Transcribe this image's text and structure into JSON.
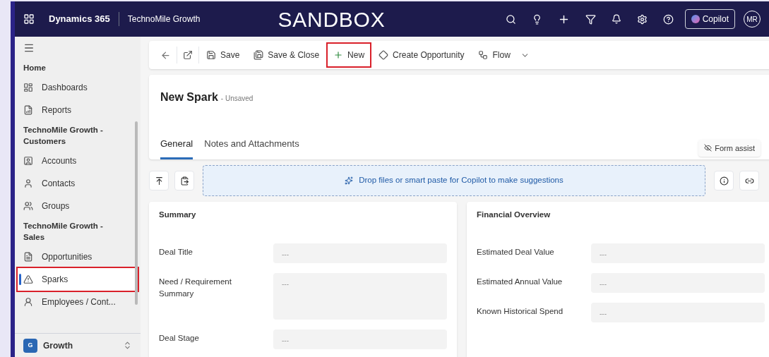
{
  "header": {
    "brand": "Dynamics 365",
    "app": "TechnoMile Growth",
    "environment": "SANDBOX",
    "copilot": "Copilot",
    "avatar": "MR"
  },
  "sidebar": {
    "groups": [
      {
        "title": "Home",
        "items": [
          {
            "label": "Dashboards",
            "selected": false,
            "highlighted": false
          },
          {
            "label": "Reports",
            "selected": false,
            "highlighted": false
          }
        ]
      },
      {
        "title": "TechnoMile Growth - Customers",
        "items": [
          {
            "label": "Accounts",
            "selected": false,
            "highlighted": false
          },
          {
            "label": "Contacts",
            "selected": false,
            "highlighted": false
          },
          {
            "label": "Groups",
            "selected": false,
            "highlighted": false
          }
        ]
      },
      {
        "title": "TechnoMile Growth - Sales",
        "items": [
          {
            "label": "Opportunities",
            "selected": false,
            "highlighted": false
          },
          {
            "label": "Sparks",
            "selected": true,
            "highlighted": true
          },
          {
            "label": "Employees / Cont...",
            "selected": false,
            "highlighted": false
          }
        ]
      }
    ],
    "area": {
      "badge": "G",
      "label": "Growth"
    }
  },
  "commands": [
    {
      "label": "Save",
      "highlighted": false
    },
    {
      "label": "Save & Close",
      "highlighted": false
    },
    {
      "label": "New",
      "highlighted": true
    },
    {
      "label": "Create Opportunity",
      "highlighted": false
    },
    {
      "label": "Flow",
      "highlighted": false
    }
  ],
  "form": {
    "title": "New Spark",
    "status": "- Unsaved",
    "tabs": [
      {
        "label": "General",
        "selected": true
      },
      {
        "label": "Notes and Attachments",
        "selected": false
      }
    ],
    "form_assist": "Form assist",
    "drop_hint": "Drop files or smart paste for Copilot to make suggestions"
  },
  "sections": [
    {
      "title": "Summary",
      "fields": [
        {
          "label": "Deal Title",
          "value": "---",
          "multiline": false
        },
        {
          "label": "Need / Requirement Summary",
          "value": "---",
          "multiline": true
        },
        {
          "label": "Deal Stage",
          "value": "---",
          "multiline": false
        }
      ]
    },
    {
      "title": "Financial Overview",
      "fields": [
        {
          "label": "Estimated Deal Value",
          "value": "---",
          "multiline": false
        },
        {
          "label": "Estimated Annual Value",
          "value": "---",
          "multiline": false
        },
        {
          "label": "Known Historical Spend",
          "value": "---",
          "multiline": false
        }
      ]
    }
  ]
}
